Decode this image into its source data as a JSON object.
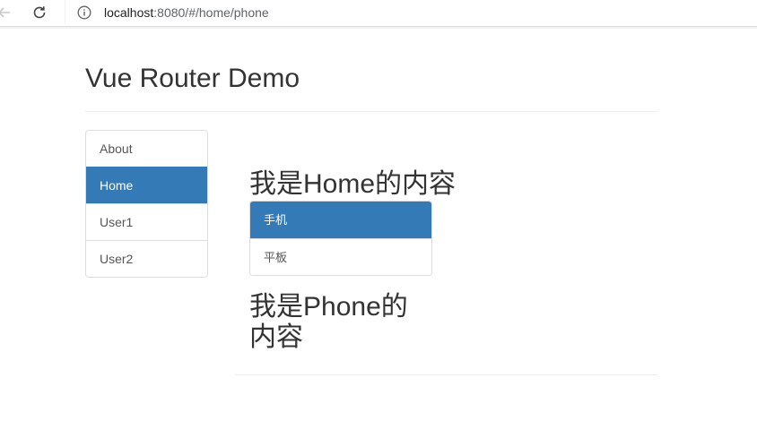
{
  "browser": {
    "url_host": "localhost",
    "url_rest": ":8080/#/home/phone",
    "icons": {
      "back": "back-arrow-icon",
      "reload": "reload-icon",
      "info": "info-icon"
    }
  },
  "page": {
    "title": "Vue Router Demo"
  },
  "sidebar": {
    "items": [
      {
        "label": "About",
        "active": false
      },
      {
        "label": "Home",
        "active": true
      },
      {
        "label": "User1",
        "active": false
      },
      {
        "label": "User2",
        "active": false
      }
    ]
  },
  "home": {
    "heading": "我是Home的内容",
    "tabs": [
      {
        "label": "手机",
        "active": true
      },
      {
        "label": "平板",
        "active": false
      }
    ]
  },
  "phone": {
    "heading": "我是Phone的内容"
  },
  "colors": {
    "active": "#337ab7",
    "border": "#dddddd",
    "text": "#333333"
  }
}
